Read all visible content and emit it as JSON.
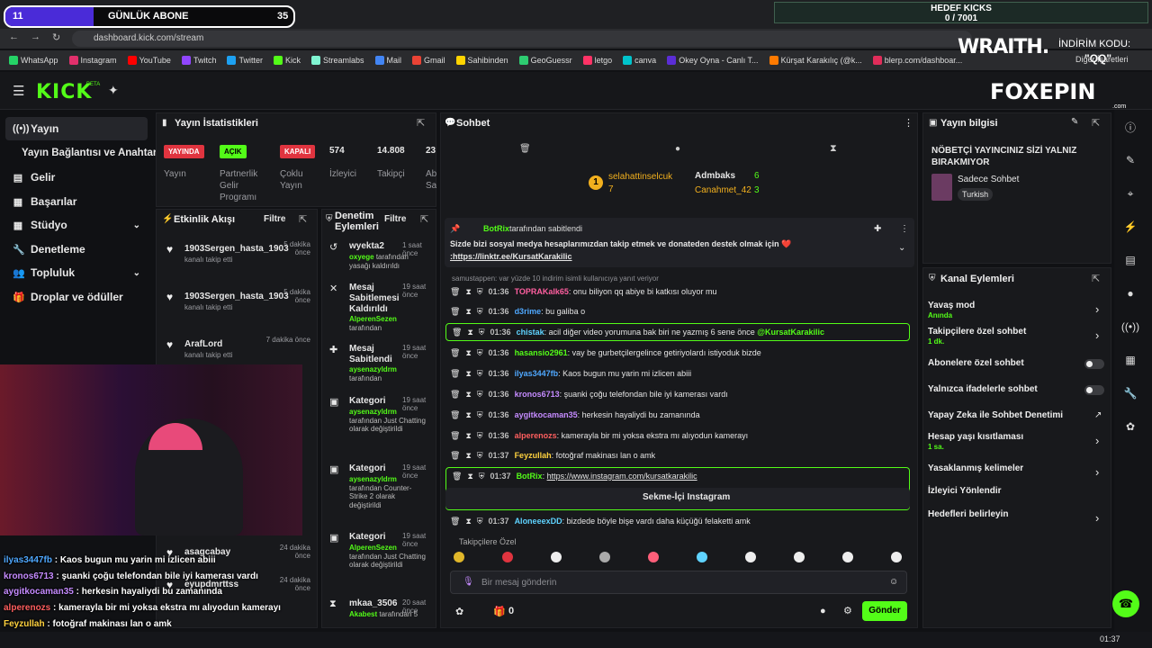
{
  "overlay": {
    "counter_left": "11",
    "counter_label": "GÜNLÜK ABONE",
    "counter_right": "35",
    "kicks_title": "HEDEF KICKS",
    "kicks_value": "0 / 7001",
    "wraith": "WRAITH.",
    "discount_label": "İNDİRİM KODU:",
    "discount_code": "\"QQ\"",
    "foxepin": "FOXEPIN",
    "foxepin_sub": ".com"
  },
  "browser": {
    "url": "dashboard.kick.com/stream",
    "bookmarks": [
      "WhatsApp",
      "Instagram",
      "YouTube",
      "Twitch",
      "Twitter",
      "Kick",
      "Streamlabs",
      "Mail",
      "Gmail",
      "Sahibinden",
      "GeoGuessr",
      "letgo",
      "canva",
      "Okey Oyna - Canlı T...",
      "Kürşat Karakılıç (@k...",
      "blerp.com/dashboar..."
    ],
    "bookmarks_right": "Diğer İşaretleri"
  },
  "header": {
    "logo": "KICK",
    "beta": "BETA"
  },
  "sidebar": {
    "items": [
      {
        "label": "Yayın"
      },
      {
        "label": "Yayın Bağlantısı ve Anahtarı"
      },
      {
        "label": "Gelir"
      },
      {
        "label": "Başarılar"
      },
      {
        "label": "Stüdyo"
      },
      {
        "label": "Denetleme"
      },
      {
        "label": "Topluluk"
      },
      {
        "label": "Droplar ve ödüller"
      }
    ]
  },
  "stats": {
    "title": "Yayın İstatistikleri",
    "cols": [
      {
        "badge": "YAYINDA",
        "label": "Yayın",
        "color": "#e0343f"
      },
      {
        "badge": "AÇIK",
        "label": "Partnerlik Gelir Programı",
        "color": "#53fc18"
      },
      {
        "badge": "KAPALI",
        "label": "Çoklu Yayın",
        "color": "#e0343f"
      },
      {
        "value": "574",
        "label": "İzleyici"
      },
      {
        "value": "14.808",
        "label": "Takipçi"
      },
      {
        "value": "23",
        "label": "Abone Sayısı"
      }
    ]
  },
  "feed": {
    "title": "Etkinlik Akışı",
    "filter": "Filtre",
    "items": [
      {
        "user": "1903Sergen_hasta_1903",
        "action": "kanalı takip etti",
        "time": "5 dakika önce"
      },
      {
        "user": "1903Sergen_hasta_1903",
        "action": "kanalı takip etti",
        "time": "5 dakika önce"
      },
      {
        "user": "ArafLord",
        "action": "kanalı takip etti",
        "time": "7 dakika önce"
      },
      {
        "user": "asagcabay",
        "action": "",
        "time": "24 dakika önce"
      },
      {
        "user": "eyupdmrttss",
        "action": "",
        "time": "24 dakika önce"
      }
    ]
  },
  "moderation": {
    "title": "Denetim Eylemleri",
    "filter": "Filtre",
    "items": [
      {
        "title": "wyekta2",
        "time": "1 saat önce",
        "actor": "oxyege",
        "detail": "tarafından yasağı kaldırıldı"
      },
      {
        "title": "Mesaj Sabitlemesi Kaldırıldı",
        "time": "19 saat önce",
        "actor": "AlperenSezen",
        "detail": "tarafından"
      },
      {
        "title": "Mesaj Sabitlendi",
        "time": "19 saat önce",
        "actor": "aysenazyldrm",
        "detail": "tarafından"
      },
      {
        "title": "Kategori",
        "time": "19 saat önce",
        "actor": "aysenazyldrm",
        "detail": "tarafından Just Chatting olarak değiştirildi"
      },
      {
        "title": "Kategori",
        "time": "19 saat önce",
        "actor": "aysenazyldrm",
        "detail": "tarafından Counter-Strike 2 olarak değiştirildi"
      },
      {
        "title": "Kategori",
        "time": "19 saat önce",
        "actor": "AlperenSezen",
        "detail": "tarafından Just Chatting olarak değiştirildi"
      },
      {
        "title": "mkaa_3506",
        "time": "20 saat önce",
        "actor": "Akabest",
        "detail": "tarafından 5"
      }
    ]
  },
  "chat": {
    "title": "Sohbet",
    "top_gifters": [
      {
        "name": "selahattinselcuk",
        "count": "7"
      },
      {
        "name": "Admbaks",
        "count": "6"
      },
      {
        "name": "Canahmet_42",
        "count": "3"
      }
    ],
    "pinned_by": "BotRix",
    "pinned_label": "tarafından sabitlendi",
    "pinned_text": "Sizde bizi sosyal medya hesaplarımızdan takip etmek ve donateden destek olmak için ❤️",
    "pinned_link": ":https://linktr.ee/KursatKarakilic",
    "reply_note": "samustappen: var yüzde 10 indirim isimli kullanıcıya yanıt veriyor",
    "messages": [
      {
        "time": "01:36",
        "user": "TOPRAKalk65",
        "color": "#ff5fa0",
        "text": ": onu biliyon qq abiye bi katkısı oluyor mu"
      },
      {
        "time": "01:36",
        "user": "d3rime",
        "color": "#4fa8ff",
        "text": ": bu galiba o"
      },
      {
        "time": "01:36",
        "user": "chistak",
        "color": "#5fd3ff",
        "text": ": acil diğer video yorumuna bak biri ne yazmış 6 sene önce ",
        "mention": "@KursatKarakilic"
      },
      {
        "time": "01:36",
        "user": "hasansio2961",
        "color": "#53fc18",
        "text": ": vay be gurbetçilergelince getiriyolardı istiyoduk bizde"
      },
      {
        "time": "01:36",
        "user": "ilyas3447fb",
        "color": "#4fa8ff",
        "text": ": Kaos bugun mu yarin mi izlicen abiii"
      },
      {
        "time": "01:36",
        "user": "kronos6713",
        "color": "#c58bff",
        "text": ": şuanki çoğu telefondan bile iyi kamerası vardı"
      },
      {
        "time": "01:36",
        "user": "aygitkocaman35",
        "color": "#c58bff",
        "text": ": herkesin hayaliydi bu zamanında"
      },
      {
        "time": "01:36",
        "user": "alperenozs",
        "color": "#ff5f5f",
        "text": ": kamerayla bir mi yoksa ekstra mı alıyodun kamerayı"
      },
      {
        "time": "01:37",
        "user": "Feyzullah",
        "color": "#ffd23f",
        "text": ": fotoğraf makinası lan o amk"
      },
      {
        "time": "01:37",
        "user": "BotRix",
        "color": "#53fc18",
        "text": ": ",
        "link": "https://www.instagram.com/kursatkarakilic"
      },
      {
        "time": "01:37",
        "user": "AloneeexDD",
        "color": "#5fd3ff",
        "text": ": bizdede böyle bişe vardı daha küçüğü felaketti amk"
      }
    ],
    "button_instagram": "Sekme-İçi Instagram",
    "followers_only": "Takipçilere Özel",
    "input_placeholder": "Bir mesaj gönderin",
    "points": "0",
    "send": "Gönder"
  },
  "stream_info": {
    "title": "Yayın bilgisi",
    "headline": "NÖBETÇİ YAYINCINIZ SİZİ YALNIZ BIRAKMIYOR",
    "category": "Sadece Sohbet",
    "tag": "Turkish"
  },
  "channel_actions": {
    "title": "Kanal Eylemleri",
    "items": [
      {
        "label": "Yavaş mod",
        "sub": "Anında",
        "ctrl": "chevron"
      },
      {
        "label": "Takipçilere özel sohbet",
        "sub": "1 dk.",
        "ctrl": "chevron"
      },
      {
        "label": "Abonelere özel sohbet",
        "sub": "",
        "ctrl": "toggle"
      },
      {
        "label": "Yalnızca ifadelerle sohbet",
        "sub": "",
        "ctrl": "toggle"
      },
      {
        "label": "Yapay Zeka ile Sohbet Denetimi",
        "sub": "",
        "ctrl": "external"
      },
      {
        "label": "Hesap yaşı kısıtlaması",
        "sub": "1 sa.",
        "ctrl": "chevron"
      },
      {
        "label": "Yasaklanmış kelimeler",
        "sub": "",
        "ctrl": "chevron"
      },
      {
        "label": "İzleyici Yönlendir",
        "sub": "",
        "ctrl": ""
      },
      {
        "label": "Hedefleri belirleyin",
        "sub": "",
        "ctrl": "chevron"
      }
    ]
  },
  "stream_chat_overlay": [
    {
      "user": "ilyas3447fb",
      "color": "#4fa8ff",
      "text": " : Kaos bugun mu yarin mi izlicen abiii"
    },
    {
      "user": "kronos6713",
      "color": "#c58bff",
      "text": " : şuanki çoğu telefondan bile iyi kamerası vardı"
    },
    {
      "user": "aygitkocaman35",
      "color": "#c58bff",
      "text": " : herkesin hayaliydi bu zamanında"
    },
    {
      "user": "alperenozs",
      "color": "#ff5f5f",
      "text": " : kamerayla bir mi yoksa ekstra mı alıyodun kamerayı"
    },
    {
      "user": "Feyzullah",
      "color": "#ffd23f",
      "text": " : fotoğraf makinası lan o amk"
    },
    {
      "user": "AloneeexDD",
      "color": "#5fd3ff",
      "text": ": bizdede böyle bişe vardı daha küçüğü felaketti amk"
    }
  ],
  "taskbar": {
    "time": "01:37"
  }
}
